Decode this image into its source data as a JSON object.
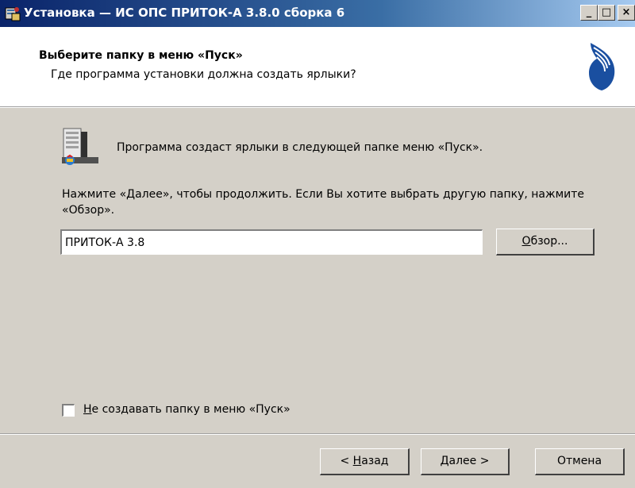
{
  "window": {
    "title": "Установка — ИС ОПС ПРИТОК-А 3.8.0 сборка 6",
    "minimize_glyph": "_",
    "maximize_glyph": "□",
    "close_glyph": "×"
  },
  "header": {
    "title": "Выберите папку в меню «Пуск»",
    "subtitle": "Где программа установки должна создать ярлыки?"
  },
  "body": {
    "info": "Программа создаст ярлыки в следующей папке меню «Пуск».",
    "hint": "Нажмите «Далее», чтобы продолжить. Если Вы хотите выбрать другую папку, нажмите «Обзор».",
    "folder_value": "ПРИТОК-А 3.8",
    "browse_accel": "О",
    "browse_rest": "бзор...",
    "checkbox_accel": "Н",
    "checkbox_rest": "е создавать папку в меню «Пуск»",
    "checkbox_checked": false
  },
  "footer": {
    "back_prefix": "< ",
    "back_accel": "Н",
    "back_rest": "азад",
    "next_accel": "Д",
    "next_rest": "алее >",
    "cancel_label": "Отмена"
  },
  "colors": {
    "titlebar_start": "#0a246a",
    "titlebar_end": "#a6caf0",
    "face": "#d4d0c8",
    "logo_blue": "#1a4fa0"
  },
  "icons": {
    "title_icon": "setup-icon",
    "logo": "company-logo-icon",
    "folder_icon": "start-menu-folder-icon"
  }
}
